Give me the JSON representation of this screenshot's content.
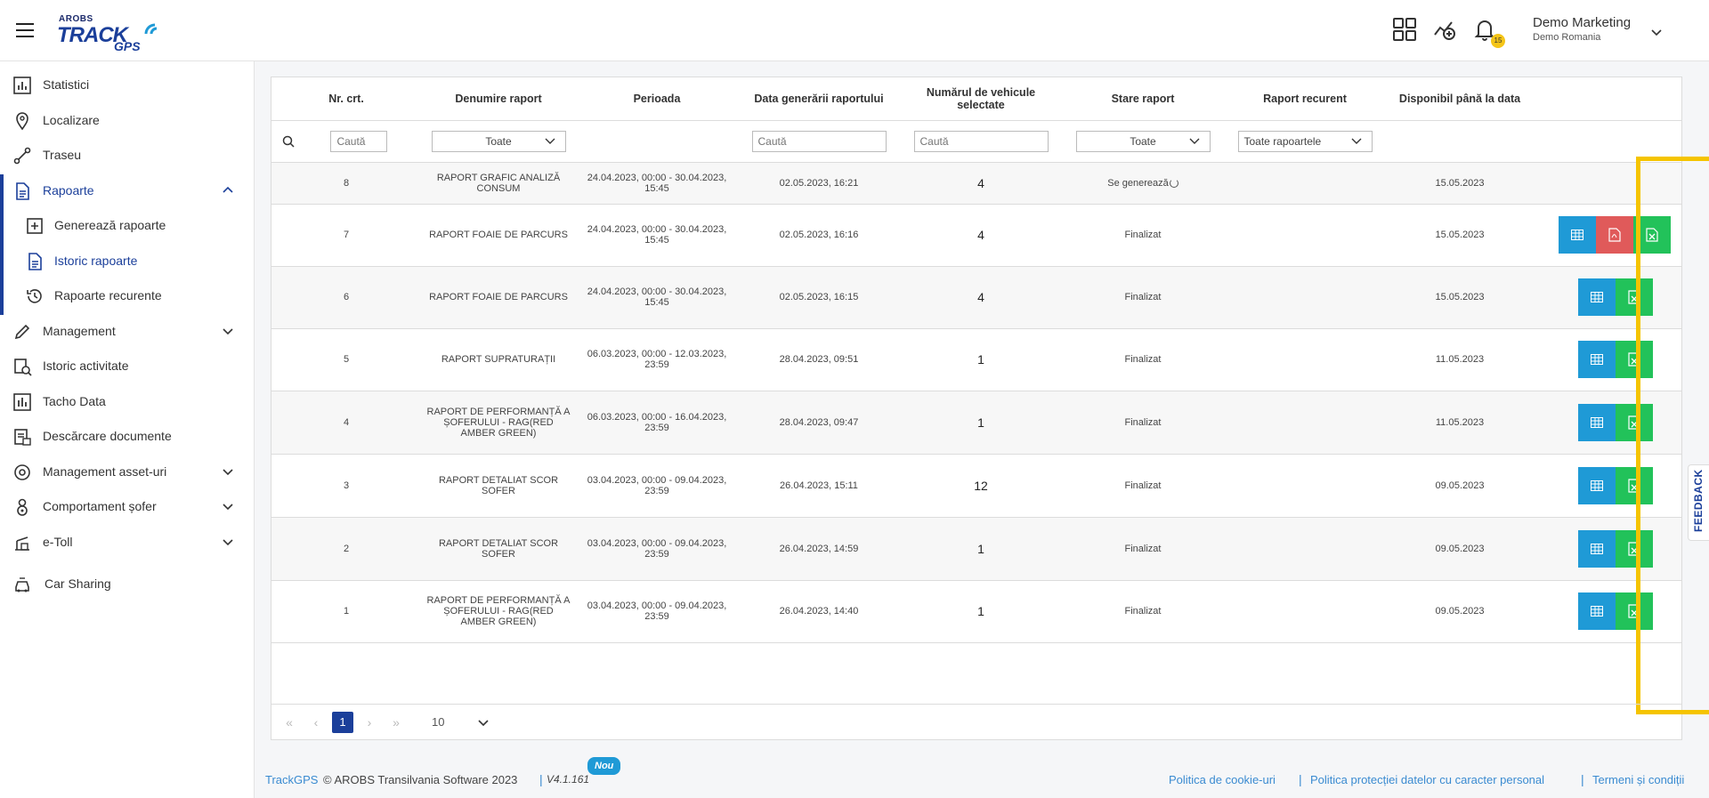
{
  "app": {
    "logo_top": "AROBS",
    "logo_main": "TRACK",
    "logo_sub": "GPS",
    "notification_count": "15",
    "user_name": "Demo Marketing",
    "user_org": "Demo Romania"
  },
  "sidebar": {
    "items": [
      {
        "label": "Statistici",
        "icon": "chart-icon"
      },
      {
        "label": "Localizare",
        "icon": "location-pin-icon"
      },
      {
        "label": "Traseu",
        "icon": "route-icon"
      },
      {
        "label": "Rapoarte",
        "icon": "document-icon"
      },
      {
        "label": "Generează rapoarte",
        "icon": "add-document-icon"
      },
      {
        "label": "Istoric rapoarte",
        "icon": "document-list-icon"
      },
      {
        "label": "Rapoarte recurente",
        "icon": "history-icon"
      },
      {
        "label": "Management",
        "icon": "pencil-icon"
      },
      {
        "label": "Istoric activitate",
        "icon": "activity-history-icon"
      },
      {
        "label": "Tacho Data",
        "icon": "bar-chart-icon"
      },
      {
        "label": "Descărcare documente",
        "icon": "download-documents-icon"
      },
      {
        "label": "Management asset-uri",
        "icon": "asset-icon"
      },
      {
        "label": "Comportament șofer",
        "icon": "driver-icon"
      },
      {
        "label": "e-Toll",
        "icon": "toll-icon"
      },
      {
        "label": "Car Sharing",
        "icon": "car-sharing-icon"
      }
    ]
  },
  "table": {
    "headers": [
      "Nr. crt.",
      "Denumire raport",
      "Perioada",
      "Data generării raportului",
      "Numărul de vehicule selectate",
      "Stare raport",
      "Raport recurent",
      "Disponibil până la data",
      ""
    ],
    "filters": {
      "search_placeholder": "Caută",
      "name_select": "Toate",
      "date_placeholder": "Caută",
      "vehicles_placeholder": "Caută",
      "status_select": "Toate",
      "recurrent_select": "Toate rapoartele"
    },
    "rows": [
      {
        "nr": "8",
        "name": "RAPORT GRAFIC ANALIZĂ CONSUM",
        "period": "24.04.2023, 00:00 - 30.04.2023, 15:45",
        "generated": "02.05.2023, 16:21",
        "vehicles": "4",
        "status": "Se generează",
        "recurrent": "",
        "available": "15.05.2023",
        "actions": []
      },
      {
        "nr": "7",
        "name": "RAPORT FOAIE DE PARCURS",
        "period": "24.04.2023, 00:00 - 30.04.2023, 15:45",
        "generated": "02.05.2023, 16:16",
        "vehicles": "4",
        "status": "Finalizat",
        "recurrent": "",
        "available": "15.05.2023",
        "actions": [
          "view",
          "pdf",
          "excel"
        ]
      },
      {
        "nr": "6",
        "name": "RAPORT FOAIE DE PARCURS",
        "period": "24.04.2023, 00:00 - 30.04.2023, 15:45",
        "generated": "02.05.2023, 16:15",
        "vehicles": "4",
        "status": "Finalizat",
        "recurrent": "",
        "available": "15.05.2023",
        "actions": [
          "view",
          "excel"
        ]
      },
      {
        "nr": "5",
        "name": "RAPORT SUPRATURAȚII",
        "period": "06.03.2023, 00:00 - 12.03.2023, 23:59",
        "generated": "28.04.2023, 09:51",
        "vehicles": "1",
        "status": "Finalizat",
        "recurrent": "",
        "available": "11.05.2023",
        "actions": [
          "view",
          "excel"
        ]
      },
      {
        "nr": "4",
        "name": "RAPORT DE PERFORMANȚĂ A ȘOFERULUI - RAG(RED AMBER GREEN)",
        "period": "06.03.2023, 00:00 - 16.04.2023, 23:59",
        "generated": "28.04.2023, 09:47",
        "vehicles": "1",
        "status": "Finalizat",
        "recurrent": "",
        "available": "11.05.2023",
        "actions": [
          "view",
          "excel"
        ]
      },
      {
        "nr": "3",
        "name": "RAPORT DETALIAT SCOR SOFER",
        "period": "03.04.2023, 00:00 - 09.04.2023, 23:59",
        "generated": "26.04.2023, 15:11",
        "vehicles": "12",
        "status": "Finalizat",
        "recurrent": "",
        "available": "09.05.2023",
        "actions": [
          "view",
          "excel"
        ]
      },
      {
        "nr": "2",
        "name": "RAPORT DETALIAT SCOR SOFER",
        "period": "03.04.2023, 00:00 - 09.04.2023, 23:59",
        "generated": "26.04.2023, 14:59",
        "vehicles": "1",
        "status": "Finalizat",
        "recurrent": "",
        "available": "09.05.2023",
        "actions": [
          "view",
          "excel"
        ]
      },
      {
        "nr": "1",
        "name": "RAPORT DE PERFORMANȚĂ A ȘOFERULUI - RAG(RED AMBER GREEN)",
        "period": "03.04.2023, 00:00 - 09.04.2023, 23:59",
        "generated": "26.04.2023, 14:40",
        "vehicles": "1",
        "status": "Finalizat",
        "recurrent": "",
        "available": "09.05.2023",
        "actions": [
          "view",
          "excel"
        ]
      }
    ]
  },
  "pagination": {
    "current": "1",
    "page_size": "10"
  },
  "footer": {
    "brand": "TrackGPS",
    "copyright": "© AROBS Transilvania Software 2023",
    "version": "V4.1.161",
    "new_badge": "Nou",
    "links": [
      "Politica de cookie-uri",
      "Politica protecției datelor cu caracter personal",
      "Termeni și condiții"
    ]
  },
  "feedback_label": "FEEDBACK",
  "colors": {
    "brand": "#1b3f9a",
    "highlight": "#f5c400",
    "view_button": "#1f9ad6",
    "pdf_button": "#e05a5a",
    "excel_button": "#22c25a"
  }
}
